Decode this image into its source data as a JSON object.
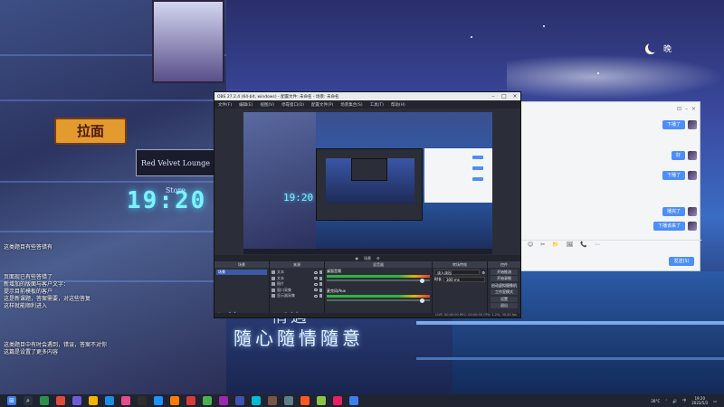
{
  "desktop": {
    "wallpaper_clock": "19:20",
    "wallpaper_sign": "拉面",
    "wallpaper_sign2": "Red Velvet Lounge Store",
    "moon_label": "晚",
    "banner_text": "隨心隨情隨意",
    "banner_text2": "情遇",
    "overlay_lines": [
      "这类题目有些答错有",
      "页面现已有些答错了",
      "新增加的版面与客户文字：",
      "提示目前模板的客户",
      "这是新课题，答案需要，对这些答复",
      "这样就能顺利进入",
      "这类题目中有时会遇到，错误，答案不对你",
      "这篇是设置了更多内容"
    ]
  },
  "obs": {
    "title": "OBS 27.2.4 (64-bit, windows) - 配置文件: 未命名 - 场景: 未命名",
    "menus": [
      "文件(F)",
      "编辑(E)",
      "视图(V)",
      "停靠窗口(D)",
      "配置文件(P)",
      "场景集合(S)",
      "工具(T)",
      "帮助(H)"
    ],
    "dockbar_label": "场景",
    "docks": {
      "scenes": {
        "title": "场景",
        "items": [
          "场景"
        ]
      },
      "sources": {
        "title": "来源",
        "items": [
          "文本",
          "文本",
          "图片",
          "窗口采集",
          "显示器采集"
        ]
      },
      "mixer": {
        "title": "混音器",
        "channels": [
          "桌面音频",
          "麦克风/Aux"
        ]
      },
      "transitions": {
        "title": "转场特效",
        "type": "淡入淡出",
        "duration_label": "时长",
        "duration": "300 ms"
      },
      "controls": {
        "title": "控件",
        "buttons": [
          "开始推流",
          "开始录制",
          "启动虚拟摄像机",
          "工作室模式",
          "设置",
          "退出"
        ]
      }
    },
    "status": "LIVE: 00:00:00  REC: 00:00:00  CPU: 1.2%, 30.00 fps"
  },
  "chat": {
    "messages": [
      "下播了",
      "好",
      "下播了",
      "播完了",
      "下播该来了"
    ],
    "timestamp": "12:06",
    "send_label": "发送(S)",
    "tools": [
      "😊",
      "✂",
      "📁",
      "🖼",
      "📞",
      "⋯"
    ]
  },
  "taskbar": {
    "tray_text": "中",
    "weather": "28°C",
    "time": "19:20",
    "date": "2022/5/3"
  },
  "colors": {
    "accent": "#4d8ef8",
    "obs_bg": "#2b2e38",
    "taskbar": "#1f2430"
  }
}
